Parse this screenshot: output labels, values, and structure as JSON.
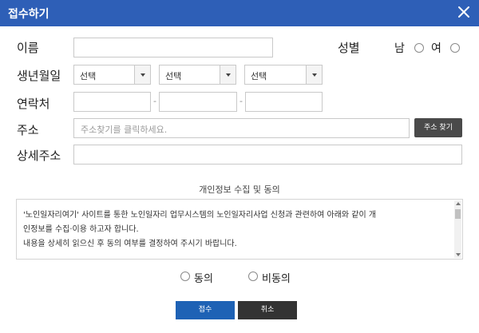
{
  "dialog": {
    "title": "접수하기",
    "close_icon": "close-icon"
  },
  "form": {
    "name_label": "이름",
    "name_value": "",
    "gender_label": "성별",
    "gender_options": [
      "남",
      "여"
    ],
    "birth_label": "생년월일",
    "birth_selects": [
      "선택",
      "선택",
      "선택"
    ],
    "contact_label": "연락처",
    "contact_separator": "-",
    "address_label": "주소",
    "address_placeholder": "주소찾기를 클릭하세요.",
    "address_search_button": "주소 찾기",
    "detail_address_label": "상세주소",
    "detail_address_value": ""
  },
  "consent": {
    "title": "개인정보 수집 및 동의",
    "body": [
      "'노인일자리여기' 사이트를 통한 노인일자리 업무시스템의 노인일자리사업 신청과 관련하여 아래와 같이 개",
      "인정보를 수집·이용 하고자 합니다.",
      "내용을 상세히 읽으신 후 동의 여부를 결정하여 주시기 바랍니다."
    ],
    "options": [
      "동의",
      "비동의"
    ]
  },
  "actions": {
    "submit_label": "접수",
    "cancel_label": "취소"
  },
  "colors": {
    "header": "#2e5fb7",
    "submit": "#1e62b5",
    "cancel": "#333333",
    "address_button": "#4a4a4a"
  }
}
